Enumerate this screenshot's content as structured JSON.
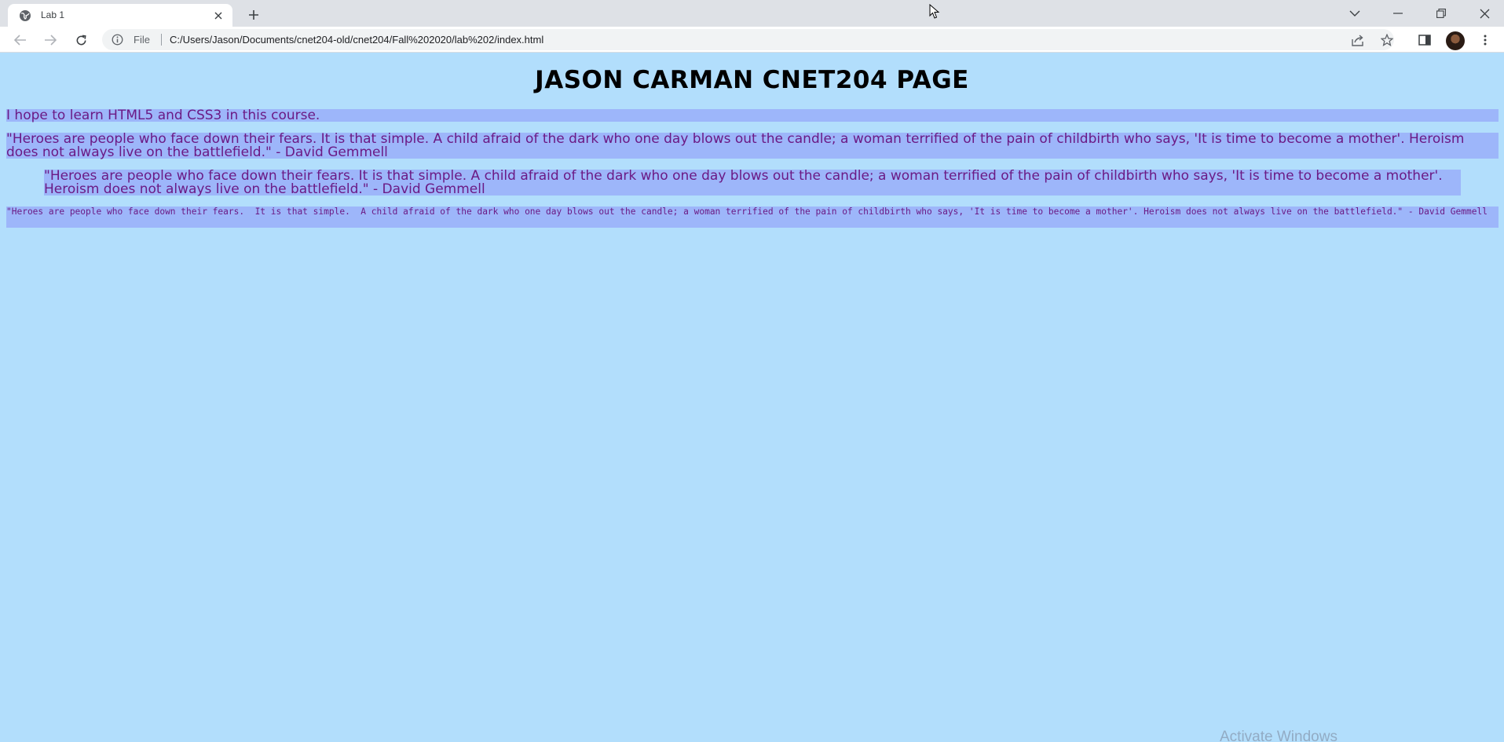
{
  "browser": {
    "tab_title": "Lab 1",
    "address_scheme_label": "File",
    "url": "C:/Users/Jason/Documents/cnet204-old/cnet204/Fall%202020/lab%202/index.html"
  },
  "page": {
    "title": "JASON CARMAN CNET204 PAGE",
    "paragraph_1": "I hope to learn HTML5 and CSS3 in this course.",
    "paragraph_2": "\"Heroes are people who face down their fears. It is that simple. A child afraid of the dark who one day blows out the candle; a woman terrified of the pain of childbirth who says, 'It is time to become a mother'. Heroism does not always live on the battlefield.\" - David Gemmell",
    "paragraph_3": "\"Heroes are people who face down their fears. It is that simple. A child afraid of the dark who one day blows out the candle; a woman terrified of the pain of childbirth who says, 'It is time to become a mother'. Heroism does not always live on the battlefield.\" - David Gemmell",
    "paragraph_4": "\"Heroes are people who face down their fears.  It is that simple.  A child afraid of the dark who one day blows out the candle; a woman terrified of the pain of childbirth who says, 'It is time to become a mother'. Heroism does not always live on the battlefield.\" - David Gemmell"
  },
  "os_watermark": "Activate Windows",
  "colors": {
    "page_background": "#b2defc",
    "paragraph_background": "#9db6fa",
    "paragraph_text": "#6b1a85"
  },
  "icons": [
    "globe-icon",
    "close-icon",
    "plus-icon",
    "chevron-down-icon",
    "minimize-icon",
    "restore-icon",
    "back-arrow-icon",
    "forward-arrow-icon",
    "reload-icon",
    "info-icon",
    "share-icon",
    "star-icon",
    "side-panel-icon",
    "kebab-menu-icon",
    "mouse-cursor-icon"
  ]
}
